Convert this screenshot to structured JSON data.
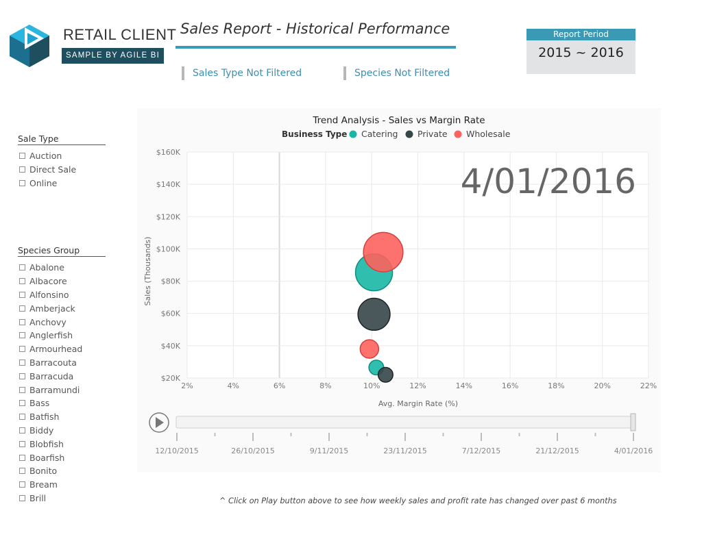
{
  "brand": {
    "name": "RETAIL CLIENT",
    "tagline": "SAMPLE BY AGILE BI",
    "colors": {
      "dark": "#1f4e5f",
      "light": "#1fa2d0",
      "mid": "#1c6f8e"
    }
  },
  "header": {
    "title": "Sales Report - Historical Performance",
    "filters": [
      "Sales Type Not Filtered",
      "Species Not Filtered"
    ],
    "report_period": {
      "label": "Report Period",
      "value": "2015 ~ 2016"
    }
  },
  "slicers": {
    "sale_type": {
      "title": "Sale Type",
      "items": [
        "Auction",
        "Direct Sale",
        "Online"
      ]
    },
    "species_group": {
      "title": "Species Group",
      "items": [
        "Abalone",
        "Albacore",
        "Alfonsino",
        "Amberjack",
        "Anchovy",
        "Anglerfish",
        "Armourhead",
        "Barracouta",
        "Barracuda",
        "Barramundi",
        "Bass",
        "Batfish",
        "Biddy",
        "Blobfish",
        "Boarfish",
        "Bonito",
        "Bream",
        "Brill"
      ]
    }
  },
  "play_axis": {
    "current_label": "4/01/2016",
    "labels": [
      "12/10/2015",
      "26/10/2015",
      "9/11/2015",
      "23/11/2015",
      "7/12/2015",
      "21/12/2015",
      "4/01/2016"
    ],
    "position": 1.0
  },
  "footnote": "^ Click on Play button above to see how weekly sales and profit rate has changed over past 6 months",
  "chart_data": {
    "type": "scatter",
    "title": "Trend Analysis - Sales vs Margin Rate",
    "legend_title": "Business Type",
    "legend_position": "top-center",
    "xlabel": "Avg. Margin Rate (%)",
    "ylabel": "Sales (Thousands)",
    "xlim": [
      2,
      22
    ],
    "ylim": [
      20,
      160
    ],
    "xticks": [
      "2%",
      "4%",
      "6%",
      "8%",
      "10%",
      "12%",
      "14%",
      "16%",
      "18%",
      "20%",
      "22%"
    ],
    "yticks": [
      "$20K",
      "$40K",
      "$60K",
      "$80K",
      "$100K",
      "$120K",
      "$140K",
      "$160K"
    ],
    "grid": true,
    "series": [
      {
        "name": "Catering",
        "color": "#19b8a6",
        "points": [
          {
            "x": 10.1,
            "y": 85.5,
            "size": 3.0
          },
          {
            "x": 10.2,
            "y": 26.5,
            "size": 1.2
          }
        ]
      },
      {
        "name": "Private",
        "color": "#374649",
        "points": [
          {
            "x": 10.1,
            "y": 59.5,
            "size": 2.6
          },
          {
            "x": 10.6,
            "y": 22.0,
            "size": 1.2
          }
        ]
      },
      {
        "name": "Wholesale",
        "color": "#fd625e",
        "points": [
          {
            "x": 10.5,
            "y": 98.0,
            "size": 3.2
          },
          {
            "x": 9.9,
            "y": 38.0,
            "size": 1.5
          }
        ]
      }
    ]
  }
}
